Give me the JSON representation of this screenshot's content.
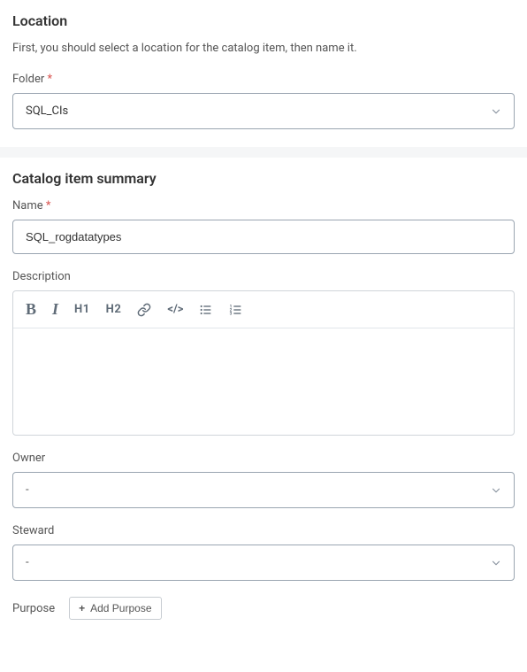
{
  "location": {
    "title": "Location",
    "intro": "First, you should select a location for the catalog item, then name it.",
    "folder_label": "Folder",
    "folder_value": "SQL_CIs"
  },
  "summary": {
    "title": "Catalog item summary",
    "name_label": "Name",
    "name_value": "SQL_rogdatatypes",
    "description_label": "Description",
    "description_value": "",
    "owner_label": "Owner",
    "owner_value": "-",
    "steward_label": "Steward",
    "steward_value": "-",
    "purpose_label": "Purpose",
    "add_purpose_label": "Add Purpose"
  },
  "required_marker": "*"
}
